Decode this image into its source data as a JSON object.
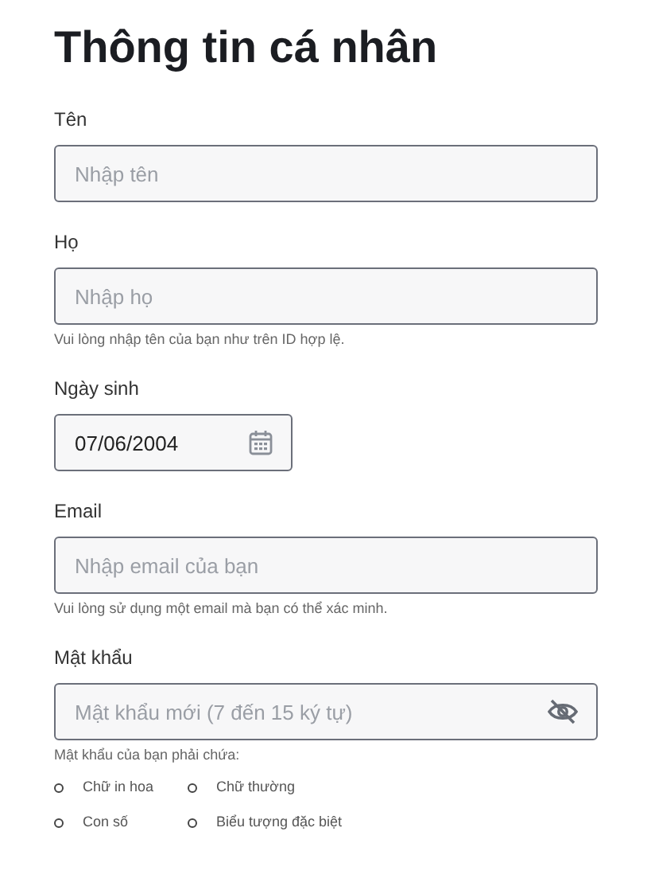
{
  "title": "Thông tin cá nhân",
  "fields": [
    {
      "kind": "text",
      "label": "Tên",
      "placeholder": "Nhập tên"
    },
    {
      "kind": "text",
      "label": "Họ",
      "placeholder": "Nhập họ",
      "hint": "Vui lòng nhập tên của bạn như trên ID hợp lệ."
    },
    {
      "kind": "date",
      "label": "Ngày sinh",
      "value": "07/06/2004"
    },
    {
      "kind": "text",
      "label": "Email",
      "placeholder": "Nhập email của bạn",
      "hint": "Vui lòng sử dụng một email mà bạn có thể xác minh."
    },
    {
      "kind": "password",
      "label": "Mật khẩu",
      "placeholder": "Mật khẩu mới (7 đến 15 ký tự)",
      "requirements_title": "Mật khẩu của bạn phải chứa:",
      "requirements": [
        "Chữ in hoa",
        "Chữ thường",
        "Con số",
        "Biểu tượng đặc biệt"
      ]
    }
  ]
}
